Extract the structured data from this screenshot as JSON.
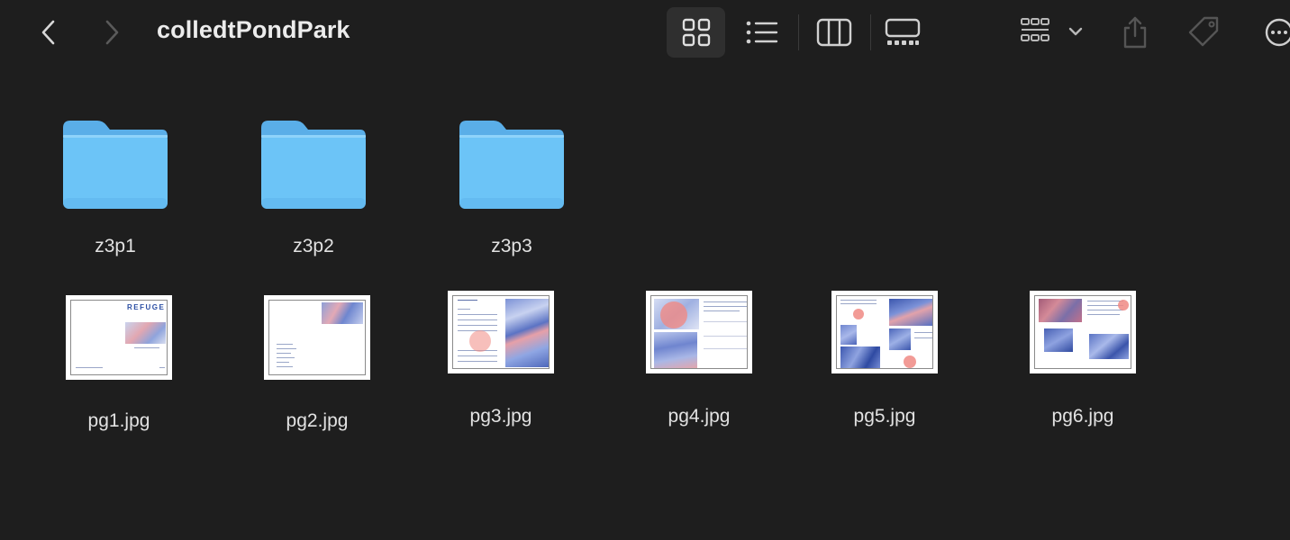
{
  "window": {
    "title": "colledtPondPark"
  },
  "toolbar": {
    "back_icon": "chevron-left-icon",
    "forward_icon": "chevron-right-icon",
    "views": [
      "icon-view",
      "list-view",
      "column-view",
      "gallery-view"
    ],
    "active_view": "icon-view",
    "group_icon": "group-by-icon",
    "share_icon": "share-icon",
    "tag_icon": "tag-icon",
    "more_icon": "more-icon"
  },
  "colors": {
    "background": "#1e1e1e",
    "folder": "#6cc4f7",
    "folder_tab": "#5aaee8",
    "text": "#e2e2e2"
  },
  "items": {
    "folders": [
      {
        "name": "z3p1"
      },
      {
        "name": "z3p2"
      },
      {
        "name": "z3p3"
      }
    ],
    "files": [
      {
        "name": "pg1.jpg"
      },
      {
        "name": "pg2.jpg"
      },
      {
        "name": "pg3.jpg"
      },
      {
        "name": "pg4.jpg"
      },
      {
        "name": "pg5.jpg"
      },
      {
        "name": "pg6.jpg"
      }
    ]
  },
  "thumbs": {
    "pg1_title": "REFUGE"
  }
}
